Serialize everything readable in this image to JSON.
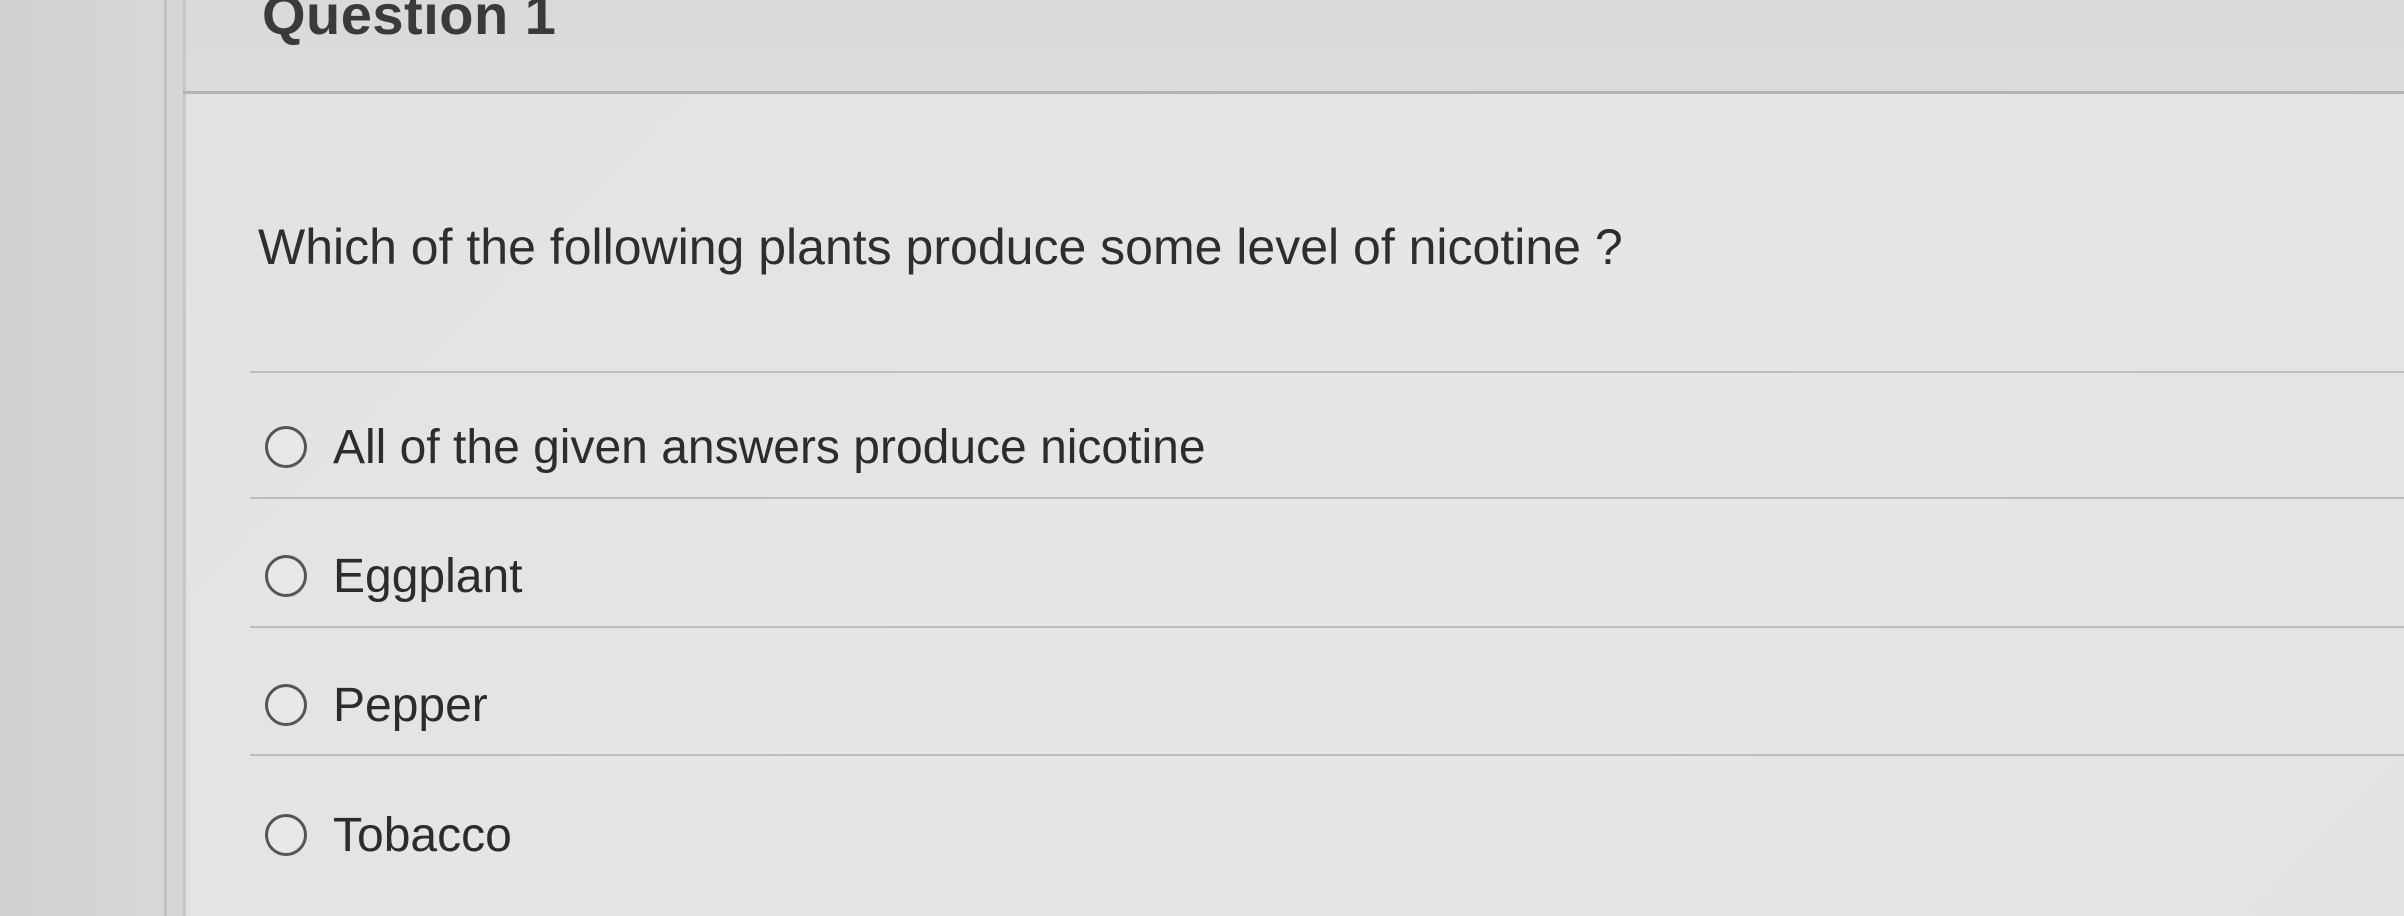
{
  "question": {
    "title": "Question 1",
    "text": "Which of the following plants produce some level of nicotine ?",
    "options": [
      {
        "label": "All of the given answers produce nicotine",
        "selected": false
      },
      {
        "label": "Eggplant",
        "selected": false
      },
      {
        "label": "Pepper",
        "selected": false
      },
      {
        "label": "Tobacco",
        "selected": false
      }
    ]
  }
}
